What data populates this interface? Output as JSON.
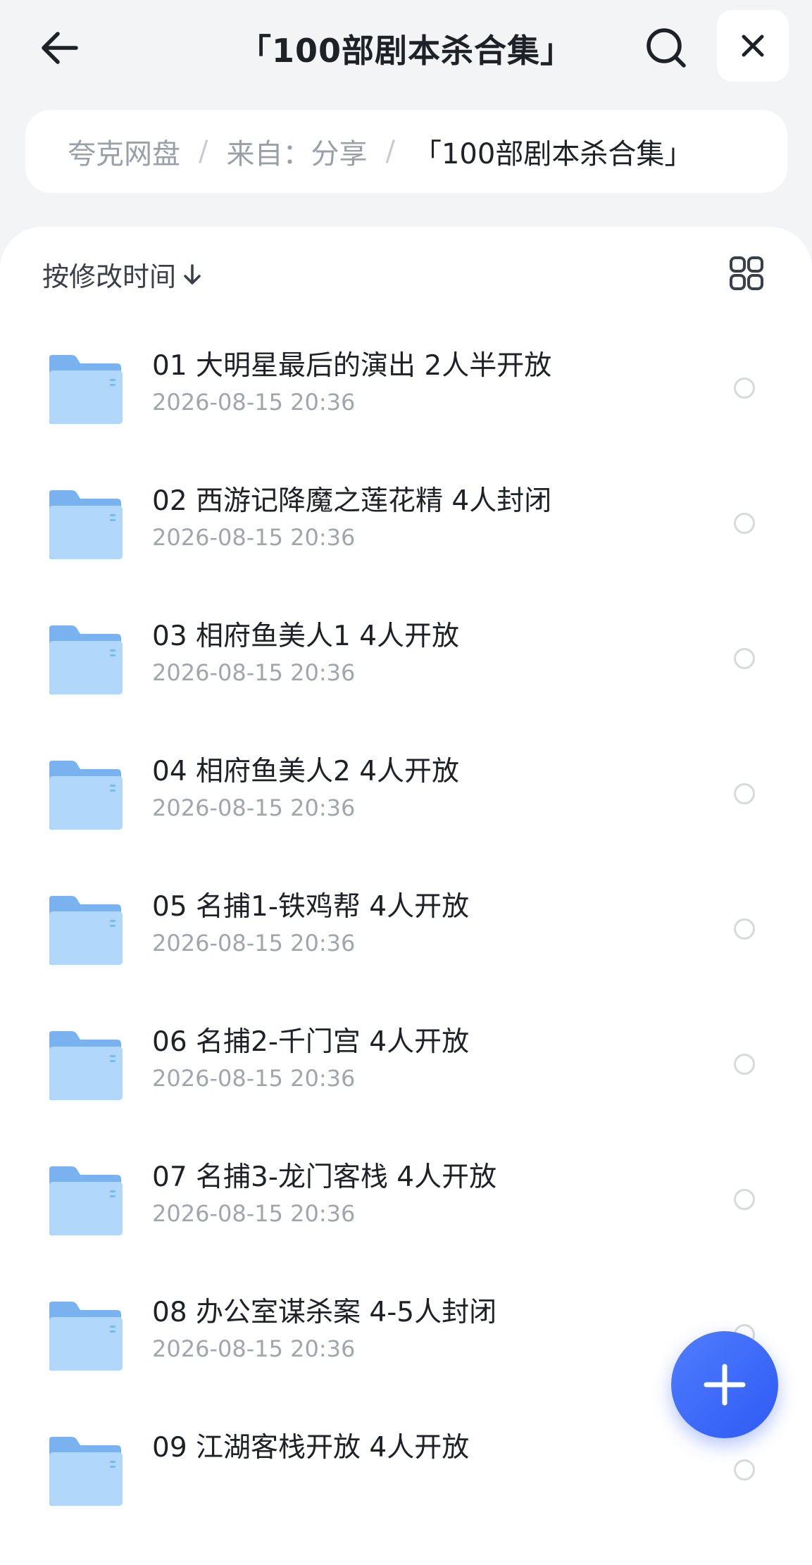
{
  "header": {
    "title": "「100部剧本杀合集」",
    "icons": {
      "back": "arrow-left-icon",
      "search": "search-icon",
      "close": "close-icon"
    }
  },
  "breadcrumb": {
    "items": [
      "夸克网盘",
      "来自：分享",
      "「100部剧本杀合集」"
    ],
    "separator": "/"
  },
  "toolbar": {
    "sort_label": "按修改时间",
    "sort_icon": "arrow-down-icon",
    "view_icon": "grid-view-icon"
  },
  "files": [
    {
      "name": "01 大明星最后的演出 2人半开放",
      "date": "2026-08-15 20:36"
    },
    {
      "name": "02 西游记降魔之莲花精 4人封闭",
      "date": "2026-08-15 20:36"
    },
    {
      "name": "03 相府鱼美人1 4人开放",
      "date": "2026-08-15 20:36"
    },
    {
      "name": "04 相府鱼美人2 4人开放",
      "date": "2026-08-15 20:36"
    },
    {
      "name": "05 名捕1-铁鸡帮 4人开放",
      "date": "2026-08-15 20:36"
    },
    {
      "name": "06 名捕2-千门宫 4人开放",
      "date": "2026-08-15 20:36"
    },
    {
      "name": "07 名捕3-龙门客栈 4人开放",
      "date": "2026-08-15 20:36"
    },
    {
      "name": "08 办公室谋杀案 4-5人封闭",
      "date": "2026-08-15 20:36"
    },
    {
      "name": "09 江湖客栈开放 4人开放",
      "date": ""
    }
  ],
  "fab": {
    "icon": "plus-icon"
  },
  "colors": {
    "accent": "#2f5af3",
    "folder": "#8fc3f5",
    "background": "#f3f4f6"
  }
}
